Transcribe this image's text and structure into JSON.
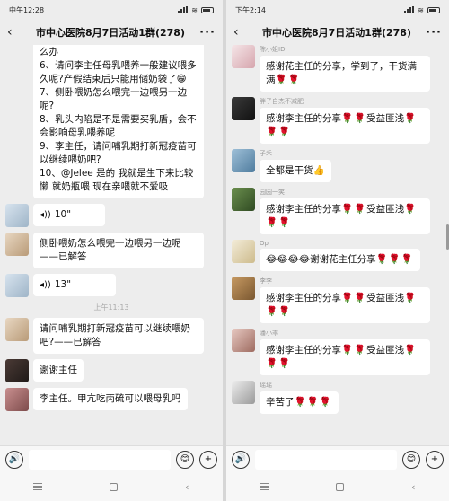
{
  "colors": {
    "rose": "#d9242b",
    "chat_bg": "#ededed",
    "bubble": "#ffffff"
  },
  "left": {
    "time": "中午12:28",
    "title": "市中心医院8月7日活动1群(278)",
    "messages": [
      {
        "type": "text",
        "lines": [
          "么办",
          "6、请问李主任母乳喂养一般建议喂多久呢?产假结束后只能用储奶袋了😁",
          "7、侧卧喂奶怎么喂完一边喂另一边呢?",
          "8、乳头内陷是不是需要买乳盾，会不会影响母乳喂养呢",
          "9、李主任，请问哺乳期打新冠疫苗可以继续喂奶吧?",
          "10、@Jelee 是的 我就是生下来比较懒 就奶瓶喂 现在亲喂就不爱吸"
        ]
      },
      {
        "type": "voice",
        "duration": "10\""
      },
      {
        "type": "text",
        "text": "侧卧喂奶怎么喂完一边喂另一边呢——已解答"
      },
      {
        "type": "voice",
        "duration": "13\""
      },
      {
        "type": "time",
        "text": "上午11:13"
      },
      {
        "type": "text",
        "text": "请问哺乳期打新冠疫苗可以继续喂奶吧?——已解答"
      },
      {
        "type": "text",
        "text": "谢谢主任"
      },
      {
        "type": "text",
        "text": "李主任。甲亢吃丙硫可以喂母乳吗"
      }
    ]
  },
  "right": {
    "time": "下午2:14",
    "title": "市中心医院8月7日活动1群(278)",
    "messages": [
      {
        "nick": "陈小姐ID",
        "text": "感谢花主任的分享，学到了，干货满满",
        "roses": "🌹🌹"
      },
      {
        "nick": "胖子自杰不减肥",
        "text": "感谢李主任的分享",
        "roses_mid": "🌹🌹",
        "text2": "受益匪浅",
        "roses": "🌹🌹🌹"
      },
      {
        "nick": "子禾",
        "text": "全都是干货👍"
      },
      {
        "nick": "园园一笑",
        "text": "感谢李主任的分享",
        "roses_mid": "🌹🌹",
        "text2": "受益匪浅",
        "roses": "🌹🌹🌹"
      },
      {
        "nick": "Op",
        "text": "😂😂😂😂谢谢花主任分享",
        "roses_mid": "🌹🌹",
        "roses": "🌹"
      },
      {
        "nick": "李李",
        "text": "感谢李主任的分享",
        "roses_mid": "🌹🌹",
        "text2": "受益匪浅",
        "roses": "🌹🌹🌹"
      },
      {
        "nick": "潘小乖",
        "text": "感谢李主任的分享",
        "roses_mid": "🌹🌹",
        "text2": "受益匪浅",
        "roses": "🌹🌹🌹"
      },
      {
        "nick": "瑶瑶",
        "text": "辛苦了",
        "roses": "🌹🌹🌹"
      }
    ]
  },
  "icons": {
    "voice_toggle": "🔊",
    "emoji": "😊",
    "plus": "+",
    "back": "‹",
    "more": "···",
    "wave": "◂))"
  }
}
